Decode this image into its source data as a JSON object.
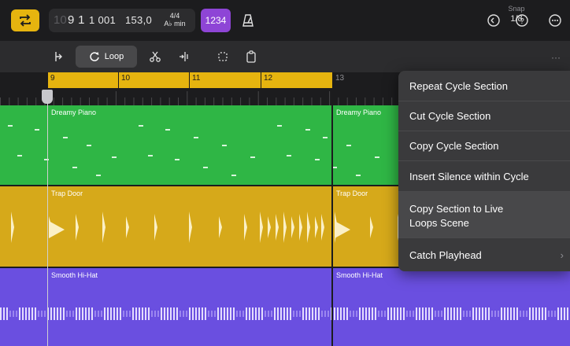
{
  "transport": {
    "position_faint": "10",
    "position_bars": "9 1",
    "position_ticks": "1 001",
    "tempo": "153,0",
    "time_signature": "4/4",
    "key": "A♭ min",
    "count_in": "1234"
  },
  "toolbar": {
    "loop_label": "Loop",
    "snap_label": "Snap",
    "snap_value": "1/8"
  },
  "ruler": {
    "bars": [
      "9",
      "10",
      "11",
      "12",
      "13"
    ]
  },
  "tracks": [
    {
      "region_name": "Dreamy Piano",
      "region_name_2": "Dreamy Piano",
      "color": "#2fb645"
    },
    {
      "region_name": "Trap Door",
      "region_name_2": "Trap Door",
      "color": "#d6a91a"
    },
    {
      "region_name": "Smooth Hi-Hat",
      "region_name_2": "Smooth Hi-Hat",
      "color": "#6a4fe0"
    }
  ],
  "menu": {
    "items": [
      "Repeat Cycle Section",
      "Cut Cycle Section",
      "Copy Cycle Section",
      "Insert Silence within Cycle",
      "Copy Section to Live",
      "Loops Scene",
      "Catch Playhead"
    ]
  },
  "colors": {
    "accent_yellow": "#e6b40f",
    "count_in_purple": "#8e45d6"
  }
}
